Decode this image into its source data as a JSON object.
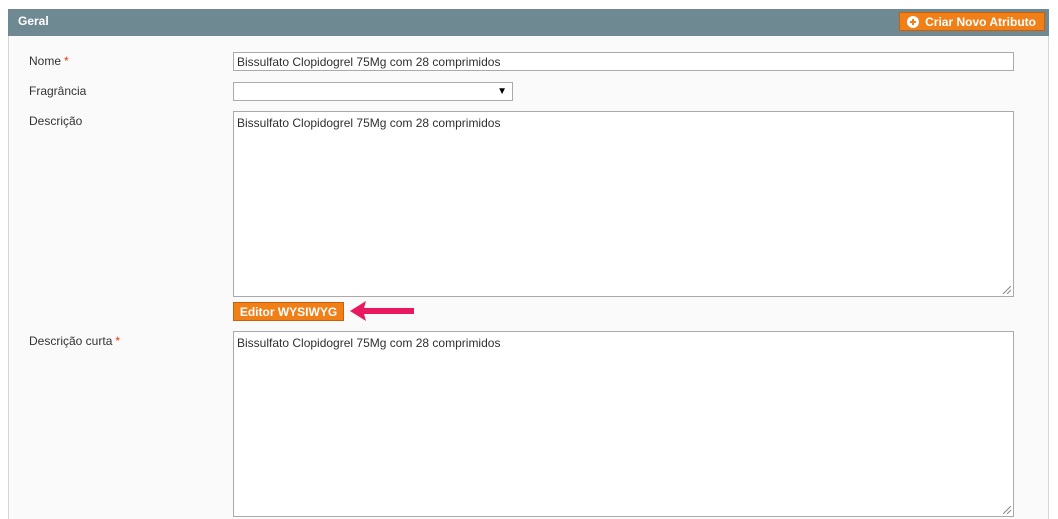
{
  "header": {
    "title": "Geral",
    "create_attribute_label": "Criar Novo Atributo"
  },
  "form": {
    "name_label": "Nome",
    "required_mark": "*",
    "name_value": "Bissulfato Clopidogrel 75Mg com 28 comprimidos",
    "fragrance_label": "Fragrância",
    "fragrance_value": "",
    "description_label": "Descrição",
    "description_value": "Bissulfato Clopidogrel 75Mg com 28 comprimidos",
    "wysiwyg_label": "Editor WYSIWYG",
    "short_description_label": "Descrição curta",
    "short_description_value": "Bissulfato Clopidogrel 75Mg com 28 comprimidos"
  },
  "colors": {
    "header_bg": "#6f8992",
    "button_orange": "#f07f18",
    "arrow_pink": "#e8195f",
    "required_red": "#eb340a"
  },
  "icons": [
    "plus-circle-icon",
    "dropdown-arrow-icon",
    "resize-grip-icon",
    "pointer-arrow-icon"
  ]
}
